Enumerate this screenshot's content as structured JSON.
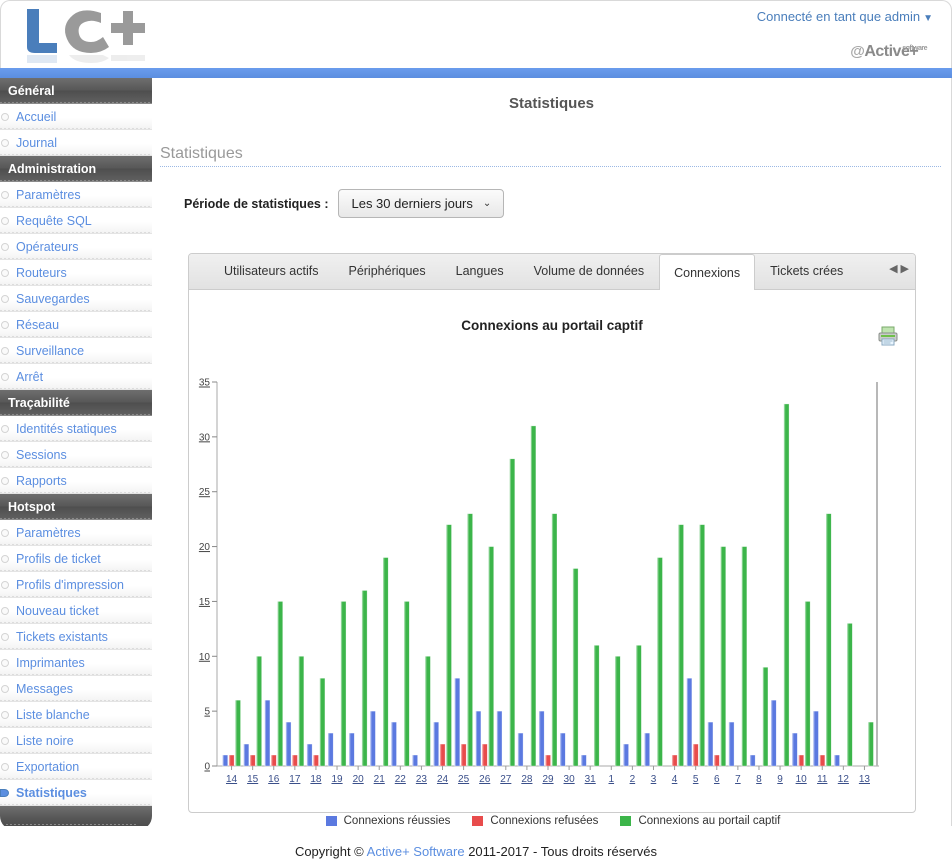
{
  "header": {
    "account_text": "Connecté en tant que admin",
    "account_caret": "▼",
    "brand_at": "@",
    "brand_name": "Active+",
    "brand_sup": "software"
  },
  "sidebar": {
    "groups": [
      {
        "label": "Général",
        "items": [
          {
            "label": "Accueil",
            "active": false
          },
          {
            "label": "Journal",
            "active": false
          }
        ]
      },
      {
        "label": "Administration",
        "items": [
          {
            "label": "Paramètres",
            "active": false
          },
          {
            "label": "Requête SQL",
            "active": false
          },
          {
            "label": "Opérateurs",
            "active": false
          },
          {
            "label": "Routeurs",
            "active": false
          },
          {
            "label": "Sauvegardes",
            "active": false
          },
          {
            "label": "Réseau",
            "active": false
          },
          {
            "label": "Surveillance",
            "active": false
          },
          {
            "label": "Arrêt",
            "active": false
          }
        ]
      },
      {
        "label": "Traçabilité",
        "items": [
          {
            "label": "Identités statiques",
            "active": false
          },
          {
            "label": "Sessions",
            "active": false
          },
          {
            "label": "Rapports",
            "active": false
          }
        ]
      },
      {
        "label": "Hotspot",
        "items": [
          {
            "label": "Paramètres",
            "active": false
          },
          {
            "label": "Profils de ticket",
            "active": false
          },
          {
            "label": "Profils d'impression",
            "active": false
          },
          {
            "label": "Nouveau ticket",
            "active": false
          },
          {
            "label": "Tickets existants",
            "active": false
          },
          {
            "label": "Imprimantes",
            "active": false
          },
          {
            "label": "Messages",
            "active": false
          },
          {
            "label": "Liste blanche",
            "active": false
          },
          {
            "label": "Liste noire",
            "active": false
          },
          {
            "label": "Exportation",
            "active": false
          },
          {
            "label": "Statistiques",
            "active": true
          }
        ]
      }
    ]
  },
  "main": {
    "page_title": "Statistiques",
    "section_title": "Statistiques",
    "period_label": "Période de statistiques :",
    "period_value": "Les 30 derniers jours",
    "period_caret": "⌄",
    "tabs": [
      {
        "label": "Utilisateurs actifs",
        "selected": false
      },
      {
        "label": "Périphériques",
        "selected": false
      },
      {
        "label": "Langues",
        "selected": false
      },
      {
        "label": "Volume de données",
        "selected": false
      },
      {
        "label": "Connexions",
        "selected": true
      },
      {
        "label": "Tickets crées",
        "selected": false
      }
    ],
    "tab_scroll_prev": "◀",
    "tab_scroll_next": "▶",
    "print_icon_name": "print-icon"
  },
  "footer": {
    "copyright_prefix": "Copyright © ",
    "company": "Active+ Software",
    "copyright_suffix": " 2011-2017 - Tous droits réservés"
  },
  "chart_data": {
    "type": "bar",
    "title": "Connexions au portail captif",
    "xlabel": "",
    "ylabel": "",
    "ylim": [
      0,
      35
    ],
    "yticks": [
      0,
      5,
      10,
      15,
      20,
      25,
      30,
      35
    ],
    "grid": false,
    "legend_position": "bottom",
    "categories": [
      "14",
      "15",
      "16",
      "17",
      "18",
      "19",
      "20",
      "21",
      "22",
      "23",
      "24",
      "25",
      "26",
      "27",
      "28",
      "29",
      "30",
      "31",
      "1",
      "2",
      "3",
      "4",
      "5",
      "6",
      "7",
      "8",
      "9",
      "10",
      "11",
      "12",
      "13"
    ],
    "series": [
      {
        "name": "Connexions réussies",
        "color": "#5b79e0",
        "values": [
          1,
          2,
          6,
          4,
          2,
          3,
          3,
          5,
          4,
          1,
          4,
          8,
          5,
          5,
          3,
          5,
          3,
          1,
          0,
          2,
          3,
          0,
          8,
          4,
          4,
          1,
          6,
          3,
          5,
          1,
          0
        ]
      },
      {
        "name": "Connexions refusées",
        "color": "#e84c4c",
        "values": [
          1,
          1,
          1,
          1,
          1,
          0,
          0,
          0,
          0,
          0,
          2,
          2,
          2,
          0,
          0,
          1,
          0,
          0,
          0,
          0,
          0,
          1,
          2,
          1,
          0,
          0,
          0,
          1,
          1,
          0,
          0
        ]
      },
      {
        "name": "Connexions au portail captif",
        "color": "#3cb54a",
        "values": [
          6,
          10,
          15,
          10,
          8,
          15,
          16,
          19,
          15,
          10,
          22,
          23,
          20,
          28,
          31,
          23,
          18,
          11,
          10,
          11,
          19,
          22,
          22,
          20,
          20,
          9,
          33,
          15,
          23,
          13,
          4
        ]
      }
    ]
  }
}
